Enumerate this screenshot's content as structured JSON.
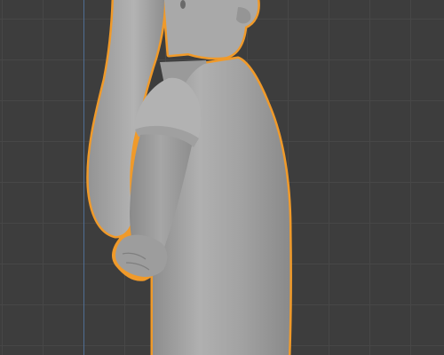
{
  "viewport": {
    "background": "#3d3d3d",
    "grid_line_color": "#474747",
    "axis_line_color": "#4f6d92",
    "selection_outline_color": "#f09a2a",
    "object_base_color": "#a8a8a8",
    "view": "side-orthographic",
    "object_selected": true
  }
}
